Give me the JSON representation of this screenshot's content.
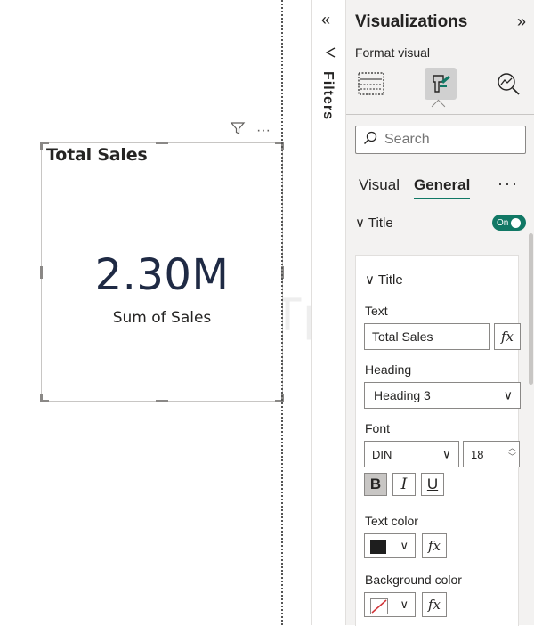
{
  "visual": {
    "title": "Total Sales",
    "value": "2.30M",
    "value_label": "Sum of Sales",
    "watermark": "javaTpoint",
    "header_icons": [
      "filter-icon",
      "more-options-icon"
    ]
  },
  "filters_pane": {
    "label": "Filters",
    "collapse_icon": "double-chevron-left-icon",
    "filter_icon": "funnel-icon"
  },
  "viz_pane": {
    "title": "Visualizations",
    "expand_icon": "double-chevron-right-icon",
    "subtitle": "Format visual",
    "tool_icons": [
      "build-visual-icon",
      "format-paint-icon",
      "analytics-icon"
    ],
    "search": {
      "placeholder": "Search"
    },
    "tabs": [
      {
        "label": "Visual",
        "active": false
      },
      {
        "label": "General",
        "active": true
      }
    ],
    "tabs_more": "···",
    "section": {
      "label": "Title",
      "toggle": "On",
      "toggle_color": "#117865"
    },
    "card": {
      "title": "Title",
      "text_label": "Text",
      "text_value": "Total Sales",
      "fx_label": "fx",
      "heading_label": "Heading",
      "heading_value": "Heading 3",
      "font_label": "Font",
      "font_family": "DIN",
      "font_size": "18",
      "format_buttons": [
        "B",
        "I",
        "U"
      ],
      "text_color_label": "Text color",
      "text_color": "#1e1e1e",
      "bg_color_label": "Background color",
      "bg_color": "none"
    }
  }
}
